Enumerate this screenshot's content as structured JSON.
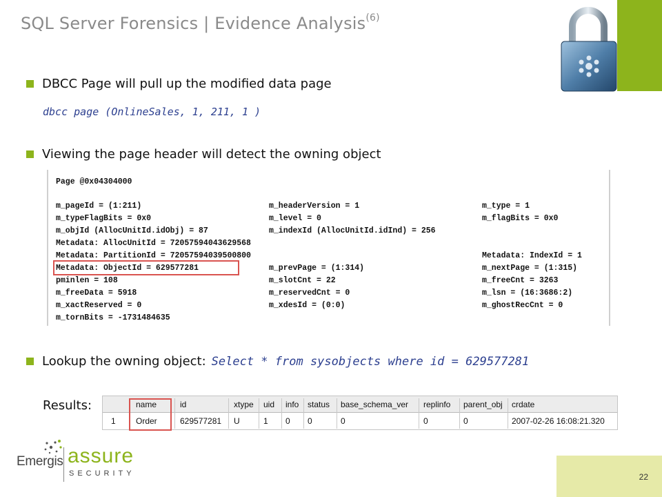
{
  "title": {
    "text": "SQL Server Forensics | Evidence Analysis",
    "sup": "(6)"
  },
  "bullets": {
    "b1": "DBCC Page will pull up the modified data page",
    "code1": "dbcc page (OnlineSales, 1, 211, 1 )",
    "b2": "Viewing the page header will detect the owning object",
    "b3_text": "Lookup the owning object:",
    "b3_code": "Select * from sysobjects where id = 629577281",
    "results_label": "Results:"
  },
  "page_dump": {
    "header": "Page @0x04304000",
    "col1": [
      "m_pageId = (1:211)",
      "m_typeFlagBits = 0x0",
      "m_objId (AllocUnitId.idObj) = 87",
      "Metadata: AllocUnitId = 72057594043629568",
      "Metadata: PartitionId = 72057594039500800",
      "Metadata: ObjectId = 629577281",
      "pminlen = 108",
      "m_freeData = 5918",
      "m_xactReserved = 0",
      "m_tornBits = -1731484635"
    ],
    "col2": [
      "m_headerVersion = 1",
      "m_level = 0",
      "m_indexId (AllocUnitId.idInd) = 256",
      "m_prevPage = (1:314)",
      "m_slotCnt = 22",
      "m_reservedCnt = 0",
      "m_xdesId = (0:0)"
    ],
    "col3": [
      "m_type = 1",
      "m_flagBits = 0x0",
      "Metadata: IndexId = 1",
      "m_nextPage = (1:315)",
      "m_freeCnt = 3263",
      "m_lsn = (16:3686:2)",
      "m_ghostRecCnt = 0"
    ]
  },
  "results_table": {
    "headers": [
      "name",
      "id",
      "xtype",
      "uid",
      "info",
      "status",
      "base_schema_ver",
      "replinfo",
      "parent_obj",
      "crdate"
    ],
    "row_num": "1",
    "row": [
      "Order",
      "629577281",
      "U",
      "1",
      "0",
      "0",
      "0",
      "0",
      "0",
      "2007-02-26 16:08:21.320"
    ]
  },
  "logo": {
    "emergis": "Emergis",
    "assure": "assure",
    "security": "SECURITY"
  },
  "page_number": "22",
  "colors": {
    "accent_green": "#8db41c",
    "footer_box": "#e6eaa8",
    "highlight_red": "#d9534f",
    "code_blue": "#2c3f8f"
  },
  "icons": {
    "lock": "padlock-icon"
  }
}
